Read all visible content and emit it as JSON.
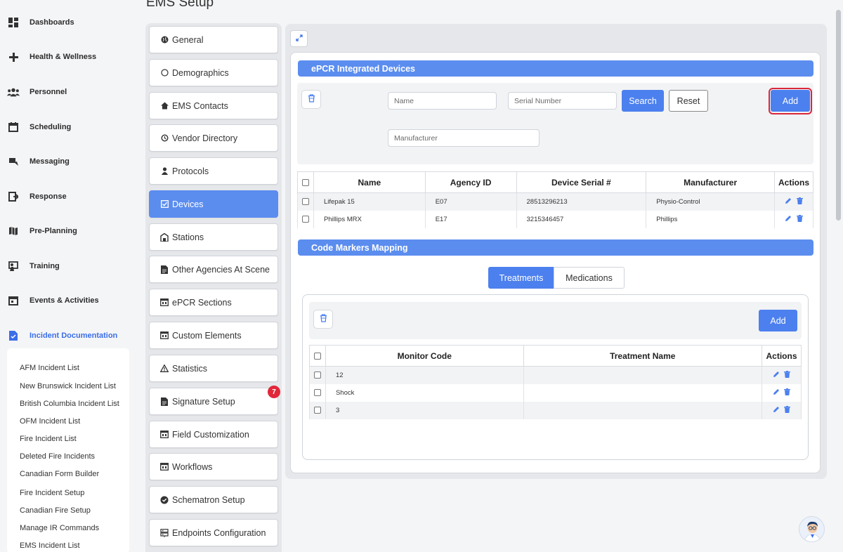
{
  "page_title": "EMS Setup",
  "nav": {
    "items": [
      {
        "label": "Dashboards",
        "icon": "dashboard-icon"
      },
      {
        "label": "Health & Wellness",
        "icon": "plus-icon"
      },
      {
        "label": "Personnel",
        "icon": "people-icon"
      },
      {
        "label": "Scheduling",
        "icon": "calendar-icon"
      },
      {
        "label": "Messaging",
        "icon": "message-icon"
      },
      {
        "label": "Response",
        "icon": "exit-icon"
      },
      {
        "label": "Pre-Planning",
        "icon": "map-icon"
      },
      {
        "label": "Training",
        "icon": "training-icon"
      },
      {
        "label": "Events & Activities",
        "icon": "calendar-event-icon"
      },
      {
        "label": "Incident Documentation",
        "icon": "document-icon",
        "active": true
      }
    ],
    "sub_items": [
      "AFM Incident List",
      "New Brunswick Incident List",
      "British Columbia Incident List",
      "OFM Incident List",
      "Fire Incident List",
      "Deleted Fire Incidents",
      "Canadian Form Builder",
      "Fire Incident Setup",
      "Canadian Fire Setup",
      "Manage IR Commands",
      "EMS Incident List"
    ]
  },
  "menu": {
    "items": [
      {
        "label": "General",
        "icon": "globe-icon"
      },
      {
        "label": "Demographics",
        "icon": "circle-icon"
      },
      {
        "label": "EMS Contacts",
        "icon": "home-icon"
      },
      {
        "label": "Vendor Directory",
        "icon": "history-icon"
      },
      {
        "label": "Protocols",
        "icon": "user-icon"
      },
      {
        "label": "Devices",
        "icon": "checkbox-icon",
        "active": true
      },
      {
        "label": "Stations",
        "icon": "building-icon"
      },
      {
        "label": "Other Agencies At Scene",
        "icon": "file-icon"
      },
      {
        "label": "ePCR Sections",
        "icon": "window-icon"
      },
      {
        "label": "Custom Elements",
        "icon": "window-icon"
      },
      {
        "label": "Statistics",
        "icon": "warning-icon"
      },
      {
        "label": "Signature Setup",
        "icon": "file-icon"
      },
      {
        "label": "Field Customization",
        "icon": "window-icon"
      },
      {
        "label": "Workflows",
        "icon": "window-icon"
      },
      {
        "label": "Schematron Setup",
        "icon": "badge-check-icon"
      },
      {
        "label": "Endpoints Configuration",
        "icon": "server-icon"
      }
    ],
    "signature_badge": "7"
  },
  "devices": {
    "section_title": "ePCR Integrated Devices",
    "name_placeholder": "Name",
    "serial_placeholder": "Serial Number",
    "manufacturer_placeholder": "Manufacturer",
    "search_label": "Search",
    "reset_label": "Reset",
    "add_label": "Add",
    "columns": [
      "Name",
      "Agency ID",
      "Device Serial #",
      "Manufacturer",
      "Actions"
    ],
    "rows": [
      {
        "name": "Lifepak 15",
        "agency": "E07",
        "serial": "28513296213",
        "manufacturer": "Physio-Control"
      },
      {
        "name": "Phillips MRX",
        "agency": "E17",
        "serial": "3215346457",
        "manufacturer": "Phillips"
      }
    ]
  },
  "codes": {
    "section_title": "Code Markers Mapping",
    "tabs": [
      "Treatments",
      "Medications"
    ],
    "add_label": "Add",
    "columns": [
      "Monitor Code",
      "Treatment Name",
      "Actions"
    ],
    "rows": [
      {
        "code": "12",
        "treatment": ""
      },
      {
        "code": "Shock",
        "treatment": ""
      },
      {
        "code": "3",
        "treatment": ""
      }
    ]
  },
  "colors": {
    "accent": "#4c80ee",
    "section_bar": "#5b8def",
    "badge": "#e0283a",
    "highlight": "#d9273a"
  }
}
